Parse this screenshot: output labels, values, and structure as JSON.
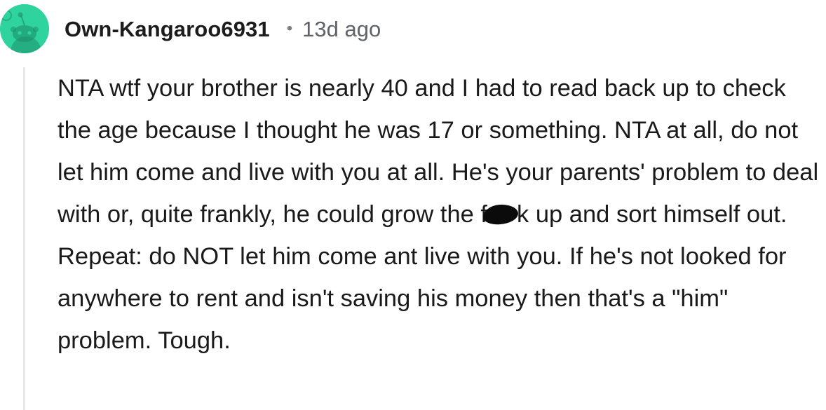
{
  "comment": {
    "author": "Own-Kangaroo6931",
    "separator": "•",
    "timestamp": "13d ago",
    "body_before_censor": "NTA wtf your brother is nearly 40 and I had to read back up to check the age because I thought he was 17 or something. NTA at all, do not let him come and live with you at all. He's your parents' problem to deal with or, quite frankly, he could grow the f",
    "body_after_censor": "k up and sort himself out. Repeat: do NOT let him come ant live with you. If he's not looked for anywhere to rent and isn't saving his money then that's a \"him\" problem. Tough."
  },
  "colors": {
    "avatar_bg": "#2fd39e",
    "thread_line": "#e9e9ea",
    "text": "#1a1a1b",
    "meta_text": "#5f6368"
  }
}
